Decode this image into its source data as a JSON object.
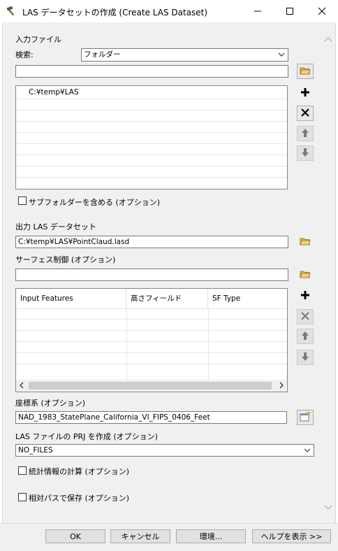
{
  "window": {
    "title": "LAS データセットの作成 (Create LAS Dataset)",
    "app_icon": "hammer-icon"
  },
  "input_files": {
    "label": "入力ファイル",
    "search_label": "検索:",
    "search_type": "フォルダー",
    "path_value": "",
    "items": [
      "C:¥temp¥LAS"
    ],
    "include_subfolders_label": "サブフォルダーを含める (オプション)",
    "include_subfolders_checked": false
  },
  "output": {
    "label": "出力 LAS データセット",
    "value": "C:¥temp¥LAS¥PointClaud.lasd"
  },
  "surface": {
    "label": "サーフェス制御 (オプション)",
    "value": "",
    "columns": [
      "Input Features",
      "高さフィールド",
      "SF Type"
    ]
  },
  "coordsys": {
    "label": "座標系 (オプション)",
    "value": "NAD_1983_StatePlane_California_VI_FIPS_0406_Feet"
  },
  "prj": {
    "label": "LAS ファイルの PRJ を作成 (オプション)",
    "value": "NO_FILES"
  },
  "stats": {
    "label": "統計情報の計算 (オプション)",
    "checked": false
  },
  "relative": {
    "label": "相対パスで保存 (オプション)",
    "checked": false
  },
  "buttons": {
    "ok": "OK",
    "cancel": "キャンセル",
    "env": "環境...",
    "help": "ヘルプを表示 >>"
  }
}
